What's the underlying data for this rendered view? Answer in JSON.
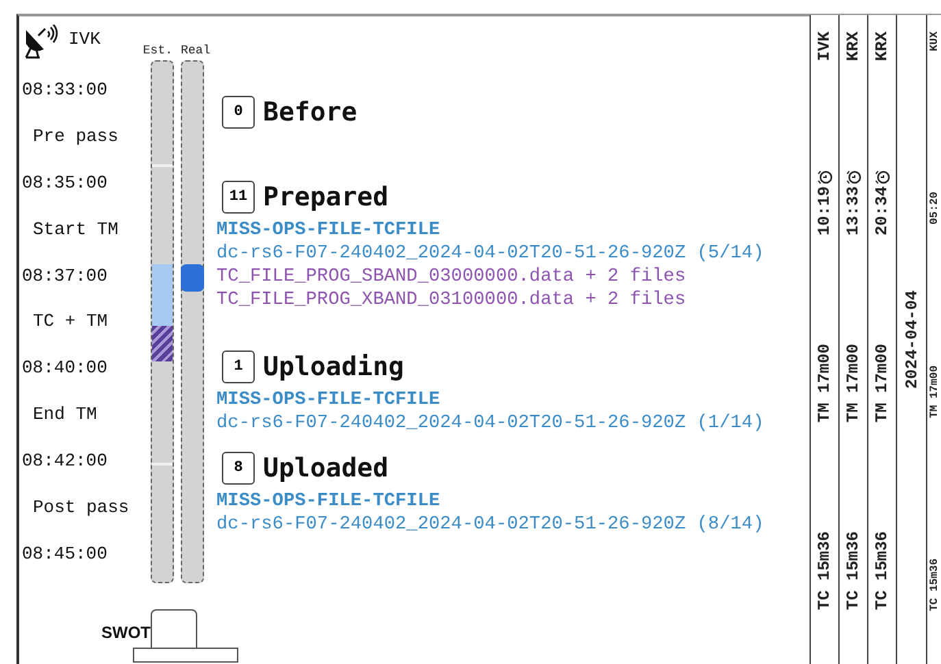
{
  "station": {
    "name": "IVK"
  },
  "bar_labels": [
    "Est.",
    "Real"
  ],
  "timeline": [
    {
      "kind": "time",
      "text": "08:33:00"
    },
    {
      "kind": "phase",
      "text": "Pre pass"
    },
    {
      "kind": "time",
      "text": "08:35:00"
    },
    {
      "kind": "phase",
      "text": "Start TM"
    },
    {
      "kind": "time",
      "text": "08:37:00"
    },
    {
      "kind": "phase",
      "text": "TC + TM"
    },
    {
      "kind": "time",
      "text": "08:40:00"
    },
    {
      "kind": "phase",
      "text": "End TM"
    },
    {
      "kind": "time",
      "text": "08:42:00"
    },
    {
      "kind": "phase",
      "text": "Post pass"
    },
    {
      "kind": "time",
      "text": "08:45:00"
    }
  ],
  "satellite": {
    "name": "SWOT"
  },
  "sections": [
    {
      "count": "0",
      "title": "Before"
    },
    {
      "count": "11",
      "title": "Prepared",
      "lines": [
        {
          "kind": "mission",
          "text": "MISS-OPS-FILE-TCFILE"
        },
        {
          "kind": "id",
          "text": "dc-rs6-F07-240402_2024-04-02T20-51-26-920Z (5/14)"
        },
        {
          "kind": "file",
          "text": "TC_FILE_PROG_SBAND_03000000.data + 2 files"
        },
        {
          "kind": "file",
          "text": "TC_FILE_PROG_XBAND_03100000.data + 2 files"
        }
      ]
    },
    {
      "count": "1",
      "title": "Uploading",
      "lines": [
        {
          "kind": "mission",
          "text": "MISS-OPS-FILE-TCFILE"
        },
        {
          "kind": "id",
          "text": "dc-rs6-F07-240402_2024-04-02T20-51-26-920Z (1/14)"
        }
      ]
    },
    {
      "count": "8",
      "title": "Uploaded",
      "lines": [
        {
          "kind": "mission",
          "text": "MISS-OPS-FILE-TCFILE"
        },
        {
          "kind": "id",
          "text": "dc-rs6-F07-240402_2024-04-02T20-51-26-920Z (8/14)"
        }
      ]
    }
  ],
  "passes": [
    {
      "kind": "pass",
      "station": "IVK",
      "time": "10:19",
      "tm": "TM 17m00",
      "tc": "TC 15m36"
    },
    {
      "kind": "pass",
      "station": "KRX",
      "time": "13:33",
      "tm": "TM 17m00",
      "tc": "TC 15m36"
    },
    {
      "kind": "pass",
      "station": "KRX",
      "time": "20:34",
      "tm": "TM 17m00",
      "tc": "TC 15m36"
    },
    {
      "kind": "date",
      "text": "2024-04-04"
    },
    {
      "kind": "pass",
      "station": "KUX",
      "time": "05:20",
      "tm": "TM 17m00",
      "tc": "TC 15m36"
    }
  ]
}
